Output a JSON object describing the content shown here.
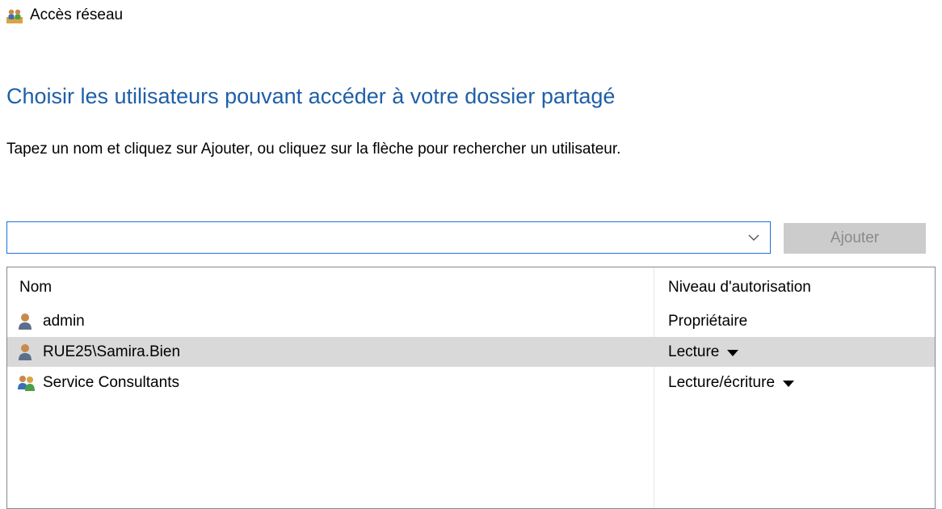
{
  "window": {
    "title": "Accès réseau",
    "icon": "network-users-icon"
  },
  "heading": "Choisir les utilisateurs pouvant accéder à votre dossier partagé",
  "instructions": "Tapez un nom et cliquez sur Ajouter, ou cliquez sur la flèche pour rechercher un utilisateur.",
  "user_input": {
    "value": "",
    "placeholder": "",
    "dropdown_icon": "chevron-down-icon"
  },
  "add_button": {
    "label": "Ajouter",
    "enabled": false
  },
  "table": {
    "columns": [
      "Nom",
      "Niveau d'autorisation"
    ],
    "rows": [
      {
        "name": "admin",
        "icon": "user-icon",
        "permission": "Propriétaire",
        "has_dropdown": false,
        "selected": false
      },
      {
        "name": "RUE25\\Samira.Bien",
        "icon": "user-icon",
        "permission": "Lecture",
        "has_dropdown": true,
        "selected": true
      },
      {
        "name": "Service Consultants",
        "icon": "group-icon",
        "permission": "Lecture/écriture",
        "has_dropdown": true,
        "selected": false
      }
    ]
  },
  "colors": {
    "heading": "#1f5fa8",
    "input_border": "#1a73d9",
    "button_disabled_bg": "#cccccc",
    "button_disabled_text": "#8a8a8a",
    "selected_row": "#d9d9d9"
  }
}
